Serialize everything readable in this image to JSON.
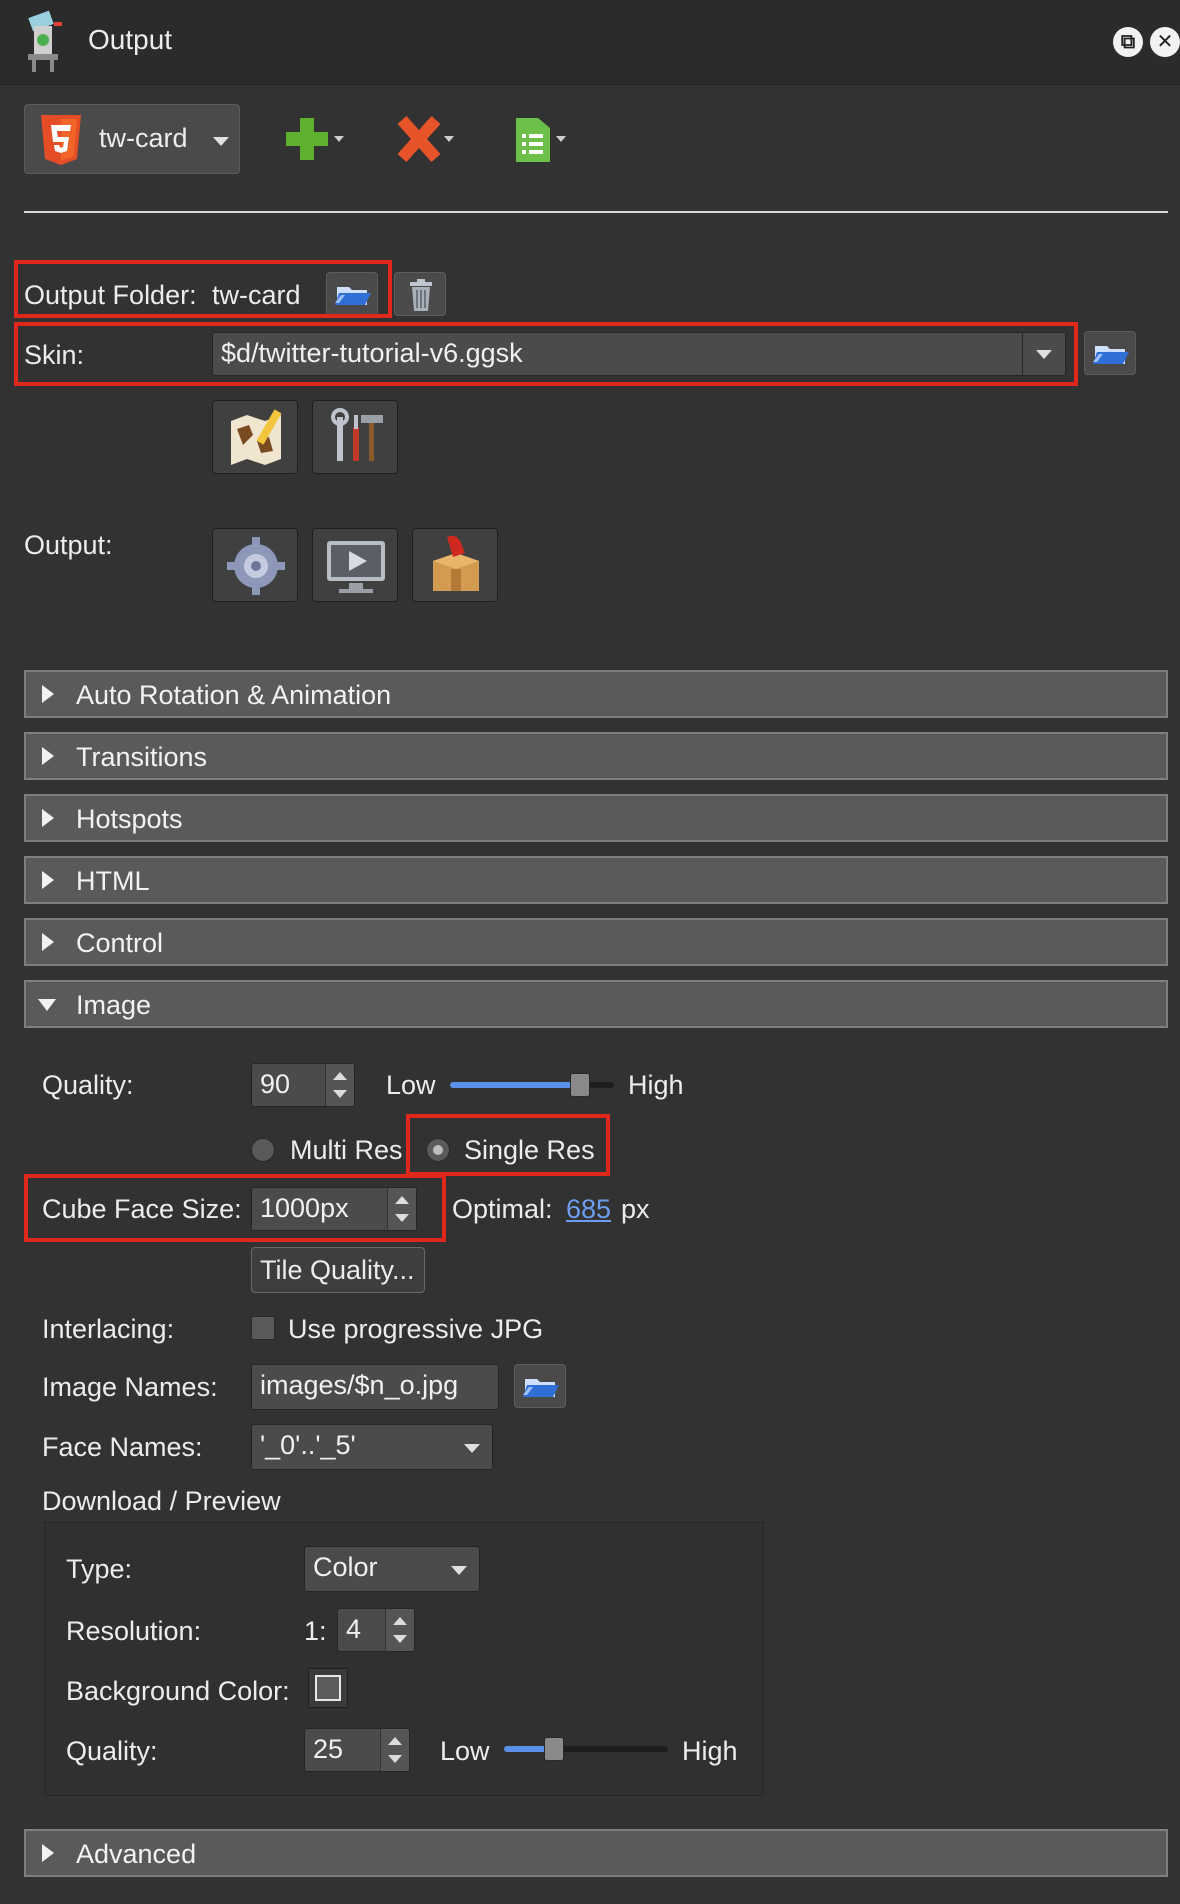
{
  "window": {
    "title": "Output"
  },
  "toolbar": {
    "output_type": "tw-card"
  },
  "main": {
    "output_folder_label": "Output Folder:",
    "output_folder_value": "tw-card",
    "skin_label": "Skin:",
    "skin_value": "$d/twitter-tutorial-v6.ggsk",
    "output_label": "Output:"
  },
  "sections": [
    {
      "label": "Auto Rotation & Animation",
      "expanded": false
    },
    {
      "label": "Transitions",
      "expanded": false
    },
    {
      "label": "Hotspots",
      "expanded": false
    },
    {
      "label": "HTML",
      "expanded": false
    },
    {
      "label": "Control",
      "expanded": false
    },
    {
      "label": "Image",
      "expanded": true
    },
    {
      "label": "Advanced",
      "expanded": false
    }
  ],
  "image": {
    "quality_label": "Quality:",
    "quality_value": "90",
    "quality_level": 0.83,
    "low_label": "Low",
    "high_label": "High",
    "multi_res_label": "Multi Res",
    "single_res_label": "Single Res",
    "cube_face_label": "Cube Face Size:",
    "cube_face_value": "1000px",
    "optimal_label": "Optimal:",
    "optimal_value": "685",
    "optimal_unit": "px",
    "tile_quality_label": "Tile Quality...",
    "interlacing_label": "Interlacing:",
    "progressive_label": "Use progressive JPG",
    "image_names_label": "Image Names:",
    "image_names_value": "images/$n_o.jpg",
    "face_names_label": "Face Names:",
    "face_names_value": "'_0'..'_5'",
    "download_preview_label": "Download / Preview"
  },
  "preview": {
    "type_label": "Type:",
    "type_value": "Color",
    "resolution_label": "Resolution:",
    "resolution_prefix": "1:",
    "resolution_value": "4",
    "bgcolor_label": "Background Color:",
    "quality_label": "Quality:",
    "quality_value": "25",
    "quality_level": 0.28,
    "low_label": "Low",
    "high_label": "High"
  },
  "colors": {
    "accent": "#5b8fe8",
    "highlight_red": "#e0281c",
    "panel": "#323232"
  }
}
